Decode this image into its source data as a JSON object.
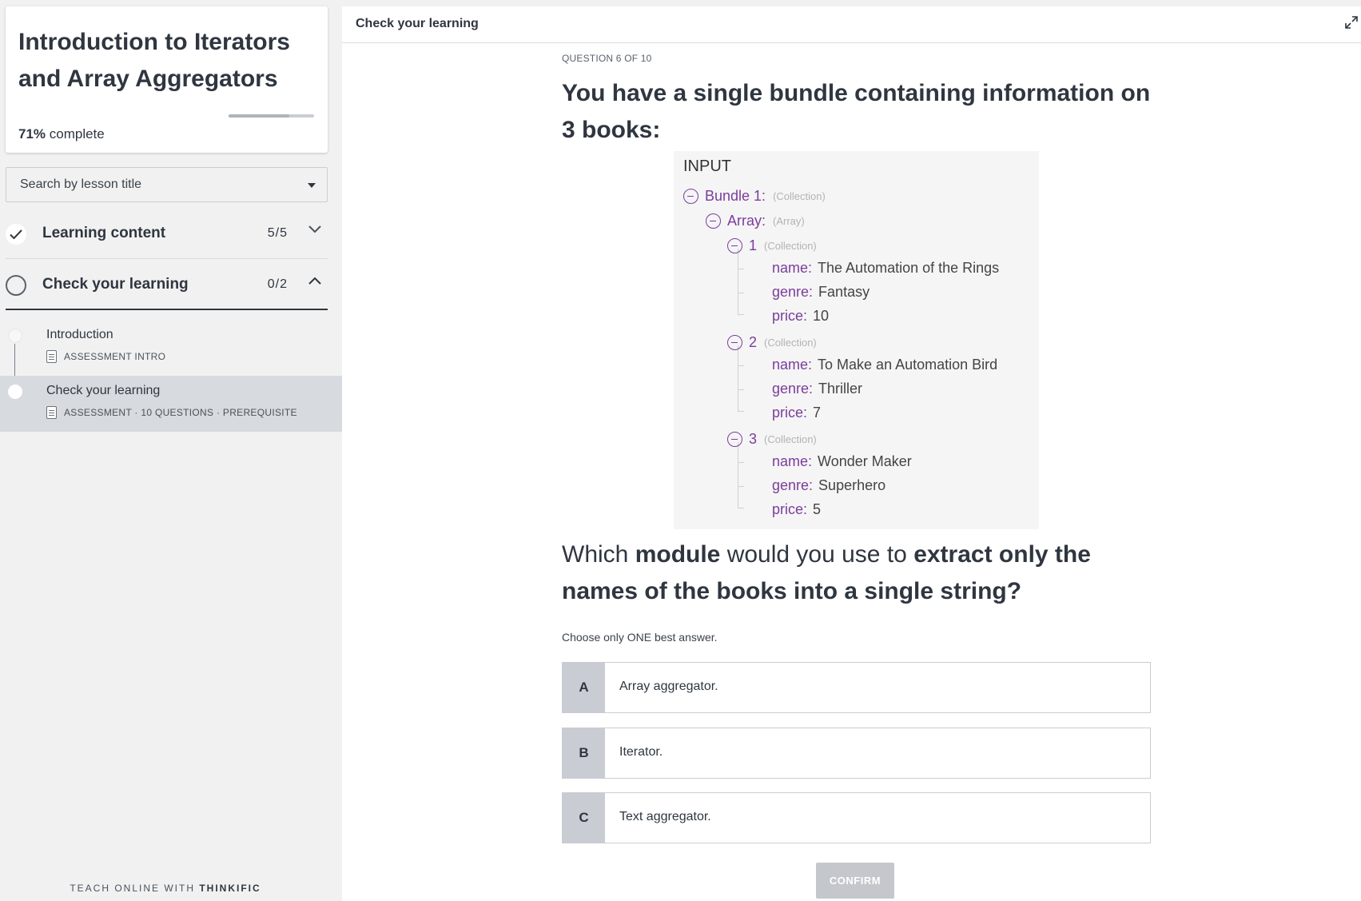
{
  "course": {
    "title": "Introduction to Iterators and Array Aggregators",
    "progress_percent": 71,
    "progress_value": "71%",
    "progress_suffix": " complete"
  },
  "search": {
    "placeholder": "Search by lesson title"
  },
  "chapters": [
    {
      "title": "Learning content",
      "count": "5/5",
      "completed": true,
      "expanded": false
    },
    {
      "title": "Check your learning",
      "count": "0/2",
      "completed": false,
      "expanded": true
    }
  ],
  "lessons": [
    {
      "title": "Introduction",
      "meta": "ASSESSMENT INTRO"
    },
    {
      "title": "Check your learning",
      "meta": "ASSESSMENT · 10 QUESTIONS · PREREQUISITE",
      "active": true
    }
  ],
  "footer": {
    "prefix": "TEACH ONLINE WITH ",
    "brand": "THINKIFIC"
  },
  "main": {
    "topbar_title": "Check your learning",
    "question_counter": "QUESTION 6 OF 10",
    "heading": "You have a single bundle containing information on 3 books:",
    "input_panel": {
      "label": "INPUT",
      "bundle_key": "Bundle 1:",
      "bundle_type": "(Collection)",
      "array_key": "Array:",
      "array_type": "(Array)",
      "items": [
        {
          "index": "1",
          "type": "(Collection)",
          "name": "The Automation of the Rings",
          "genre": "Fantasy",
          "price": "10"
        },
        {
          "index": "2",
          "type": "(Collection)",
          "name": "To Make an Automation Bird",
          "genre": "Thriller",
          "price": "7"
        },
        {
          "index": "3",
          "type": "(Collection)",
          "name": "Wonder Maker",
          "genre": "Superhero",
          "price": "5"
        }
      ],
      "field_labels": {
        "name": "name:",
        "genre": "genre:",
        "price": "price:"
      }
    },
    "sub_question": {
      "p1": "Which ",
      "b1": "module",
      "p2": " would you use to ",
      "b2": "extract only the names of the books into a single string?"
    },
    "hint": "Choose only ONE best answer.",
    "options": [
      {
        "letter": "A",
        "text": "Array aggregator."
      },
      {
        "letter": "B",
        "text": "Iterator."
      },
      {
        "letter": "C",
        "text": "Text aggregator."
      }
    ],
    "confirm_label": "CONFIRM"
  }
}
